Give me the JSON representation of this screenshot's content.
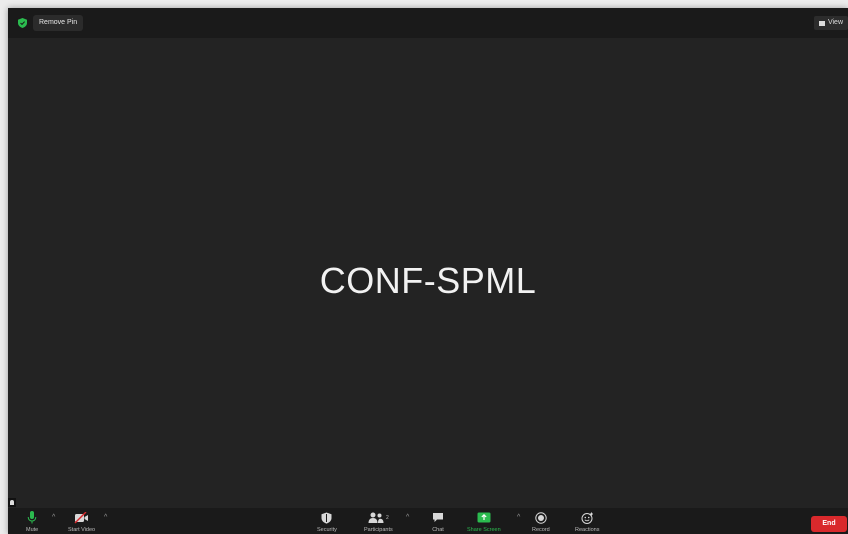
{
  "topbar": {
    "pin_label": "Remove Pin",
    "view_label": "View",
    "shield_color": "#2bbb4f"
  },
  "stage": {
    "participant_name": "CONF-SPML"
  },
  "toolbar": {
    "mute_label": "Mute",
    "start_video_label": "Start Video",
    "security_label": "Security",
    "participants_label": "Participants",
    "participants_count": "2",
    "chat_label": "Chat",
    "share_screen_label": "Share Screen",
    "record_label": "Record",
    "reactions_label": "Reactions",
    "end_label": "End",
    "accent_green": "#2bbb4f",
    "end_color": "#d9292c"
  }
}
